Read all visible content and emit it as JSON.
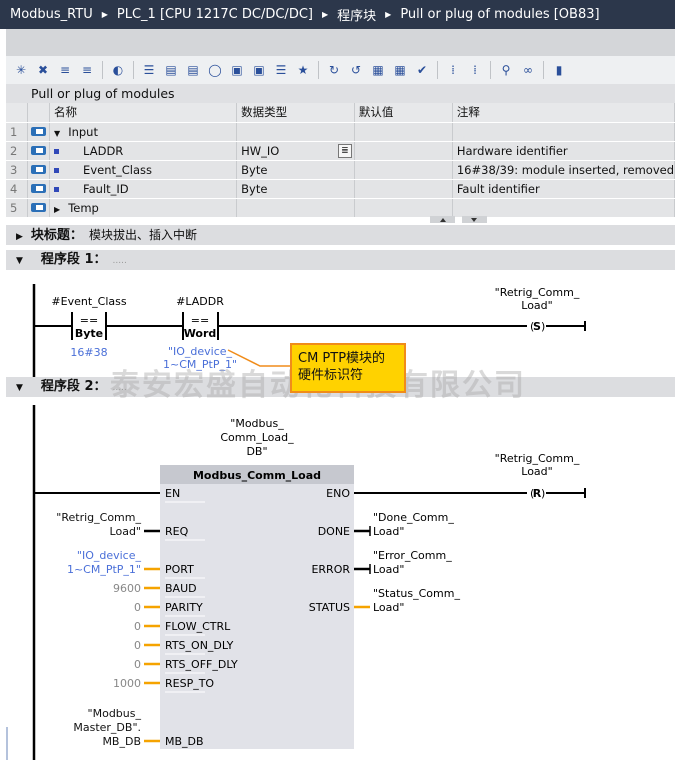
{
  "titlebar": {
    "crumbs": [
      "Modbus_RTU",
      "PLC_1 [CPU 1217C DC/DC/DC]",
      "程序块",
      "Pull or plug of modules [OB83]"
    ]
  },
  "toolbar": {
    "icons": [
      "insert-network-icon",
      "delete-network-icon",
      "insert-row-icon",
      "append-row-icon",
      "plc-icon",
      "list-icon",
      "collapse-icon",
      "expand-icon",
      "comment-icon",
      "operand-icon",
      "symbol-icon",
      "info-icon",
      "favorites-icon",
      "reset-start-icon",
      "reset-stop-icon",
      "monitor-icon",
      "monitor2-icon",
      "compare-icon",
      "jump-icon",
      "jump2-icon",
      "search-icon",
      "glasses-icon",
      "split-icon"
    ]
  },
  "block": {
    "name": "Pull or plug of modules"
  },
  "interface": {
    "headers": [
      "名称",
      "数据类型",
      "默认值",
      "注释"
    ],
    "rows": [
      {
        "num": "1",
        "name": "Input",
        "type": "",
        "default": "",
        "comment": "",
        "kind": "section-open"
      },
      {
        "num": "2",
        "name": "LADDR",
        "type": "HW_IO",
        "default": "",
        "comment": "Hardware identifier",
        "kind": "param"
      },
      {
        "num": "3",
        "name": "Event_Class",
        "type": "Byte",
        "default": "",
        "comment": "16#38/39: module inserted, removed",
        "kind": "param"
      },
      {
        "num": "4",
        "name": "Fault_ID",
        "type": "Byte",
        "default": "",
        "comment": "Fault identifier",
        "kind": "param"
      },
      {
        "num": "5",
        "name": "Temp",
        "type": "",
        "default": "",
        "comment": "",
        "kind": "section-closed"
      }
    ]
  },
  "block_title": {
    "label": "块标题：",
    "value": "模块拔出、插入中断"
  },
  "network1": {
    "label": "程序段 1：",
    "comment": ".....",
    "contact1": {
      "operand": "#Event_Class",
      "op": "==",
      "type": "Byte",
      "value": "16#38"
    },
    "contact2": {
      "operand": "#LADDR",
      "op": "==",
      "type": "Word",
      "value1": "\"IO_device_",
      "value2": "1~CM_PtP_1\""
    },
    "coil": {
      "operand1": "\"Retrig_Comm_",
      "operand2": "Load\"",
      "type": "S"
    },
    "callout": {
      "line1": "CM PTP模块的",
      "line2": "硬件标识符"
    }
  },
  "watermark": "泰安宏盛自动化科技有限公司",
  "network2": {
    "label": "程序段 2：",
    "comment": ".....",
    "instance": [
      "\"Modbus_",
      "Comm_Load_",
      "DB\""
    ],
    "block_name": "Modbus_Comm_Load",
    "inputs": [
      {
        "pin": "EN",
        "value": []
      },
      {
        "pin": "REQ",
        "value": [
          "\"Retrig_Comm_",
          "Load\""
        ]
      },
      {
        "pin": "PORT",
        "value": [
          "\"IO_device_",
          "1~CM_PtP_1\""
        ]
      },
      {
        "pin": "BAUD",
        "value": [
          "9600"
        ]
      },
      {
        "pin": "PARITY",
        "value": [
          "0"
        ]
      },
      {
        "pin": "FLOW_CTRL",
        "value": [
          "0"
        ]
      },
      {
        "pin": "RTS_ON_DLY",
        "value": [
          "0"
        ]
      },
      {
        "pin": "RTS_OFF_DLY",
        "value": [
          "0"
        ]
      },
      {
        "pin": "RESP_TO",
        "value": [
          "1000"
        ]
      },
      {
        "pin": "MB_DB",
        "value": [
          "\"Modbus_",
          "Master_DB\".",
          "MB_DB"
        ]
      }
    ],
    "outputs": [
      {
        "pin": "ENO",
        "value": []
      },
      {
        "pin": "DONE",
        "value": [
          "\"Done_Comm_",
          "Load\""
        ]
      },
      {
        "pin": "ERROR",
        "value": [
          "\"Error_Comm_",
          "Load\""
        ]
      },
      {
        "pin": "STATUS",
        "value": [
          "\"Status_Comm_",
          "Load\""
        ]
      }
    ],
    "coil": {
      "operand1": "\"Retrig_Comm_",
      "operand2": "Load\"",
      "type": "R"
    }
  },
  "colors": {
    "titlebar": "#2c374b",
    "constant": "#4a6fd8",
    "wire_data": "#f5a300",
    "callout": "#ffd200",
    "callout_border": "#f08c1a",
    "block_bg": "#e1e2e8"
  }
}
